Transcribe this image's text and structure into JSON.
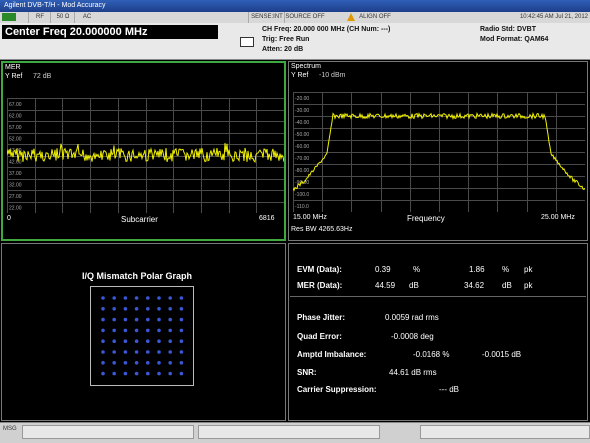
{
  "window": {
    "title": "Agilent DVB-T/H - Mod Accuracy"
  },
  "status_bar": {
    "cells": [
      "RF",
      "50 Ω",
      "AC",
      "SENSE:INT",
      "SOURCE OFF",
      "ALIGN OFF"
    ],
    "time": "10:42:45 AM Jul 21, 2012"
  },
  "header": {
    "center_freq": "Center Freq 20.000000 MHz",
    "ch_freq": "CH Freq: 20.000 000 MHz (CH Num: ---)",
    "trig": "Trig: Free Run",
    "atten": "Atten: 20 dB",
    "radio_std": "Radio Std: DVBT",
    "mod_format": "Mod Format: QAM64"
  },
  "mer_panel": {
    "title": "MER",
    "yref": "Y Ref",
    "yref_value": "72 dB",
    "x_start": "0",
    "x_end": "6816",
    "xlabel": "Subcarrier",
    "y_ticks": [
      "67.00",
      "62.00",
      "57.00",
      "52.00",
      "47.00",
      "42.00",
      "37.00",
      "32.00",
      "27.00",
      "22.00"
    ]
  },
  "spectrum_panel": {
    "title": "Spectrum",
    "yref": "Y Ref",
    "yref_value": "-10 dBm",
    "x_start": "15.00 MHz",
    "x_end": "25.00 MHz",
    "xlabel": "Frequency",
    "res_bw": "Res BW 4265.63Hz",
    "y_ticks": [
      "-20.00",
      "-30.00",
      "-40.00",
      "-50.00",
      "-60.00",
      "-70.00",
      "-80.00",
      "-90.00",
      "-100.0",
      "-110.0"
    ]
  },
  "iq_panel": {
    "title": "I/Q Mismatch Polar Graph"
  },
  "results": {
    "evm_label": "EVM (Data):",
    "evm_rms": "0.39",
    "evm_rms_unit": "%",
    "evm_pk": "1.86",
    "evm_pk_unit": "%",
    "evm_pk_suffix": "pk",
    "mer_label": "MER (Data):",
    "mer_rms": "44.59",
    "mer_rms_unit": "dB",
    "mer_pk": "34.62",
    "mer_pk_unit": "dB",
    "mer_pk_suffix": "pk",
    "phase_jitter_label": "Phase Jitter:",
    "phase_jitter_value": "0.0059 rad rms",
    "quad_error_label": "Quad Error:",
    "quad_error_value": "-0.0008 deg",
    "amptd_label": "Amptd Imbalance:",
    "amptd_value1": "-0.0168 %",
    "amptd_value2": "-0.0015 dB",
    "snr_label": "SNR:",
    "snr_value": "44.61 dB rms",
    "carrier_label": "Carrier Suppression:",
    "carrier_value": "--- dB"
  },
  "msg_bar": {
    "label": "MSG"
  },
  "colors": {
    "trace": "#f2f200",
    "grid": "#4a4a4a",
    "active_border": "#3fa83f"
  }
}
